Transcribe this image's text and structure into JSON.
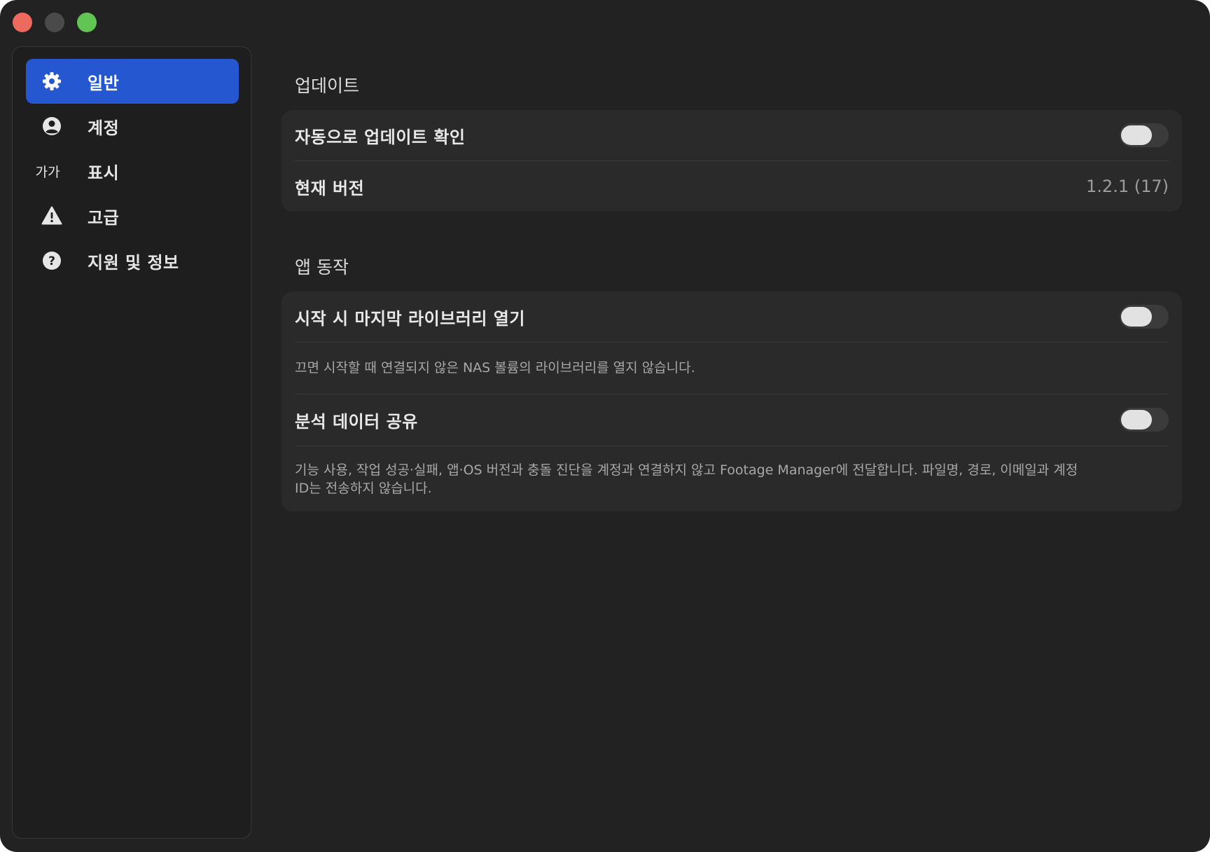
{
  "sidebar": {
    "items": [
      {
        "label": "일반",
        "icon": "gear-icon",
        "active": true
      },
      {
        "label": "계정",
        "icon": "person-circle-icon",
        "active": false
      },
      {
        "label": "표시",
        "icon": "text-size-icon",
        "icon_text": "가가",
        "active": false
      },
      {
        "label": "고급",
        "icon": "warning-triangle-icon",
        "active": false
      },
      {
        "label": "지원 및 정보",
        "icon": "question-circle-icon",
        "active": false
      }
    ]
  },
  "sections": {
    "update": {
      "title": "업데이트",
      "auto_update_label": "자동으로 업데이트 확인",
      "auto_update_enabled": false,
      "version_label": "현재 버전",
      "version_value": "1.2.1 (17)"
    },
    "app_behavior": {
      "title": "앱 동작",
      "open_last_library_label": "시작 시 마지막 라이브러리 열기",
      "open_last_library_enabled": false,
      "open_last_library_desc": "끄면 시작할 때 연결되지 않은 NAS 볼륨의 라이브러리를 열지 않습니다.",
      "analytics_label": "분석 데이터 공유",
      "analytics_enabled": false,
      "analytics_desc_line1": "기능 사용, 작업 성공·실패, 앱·OS 버전과 충돌 진단을 계정과 연결하지 않고 Footage Manager에 전달합니다. 파일명, 경로, 이메일과 계정",
      "analytics_desc_line2": "ID는 전송하지 않습니다."
    }
  },
  "colors": {
    "accent": "#2557d0",
    "window_bg": "#222222",
    "card_bg": "#2a2a2a",
    "traffic_red": "#ed6a5e",
    "traffic_green": "#61c554"
  }
}
